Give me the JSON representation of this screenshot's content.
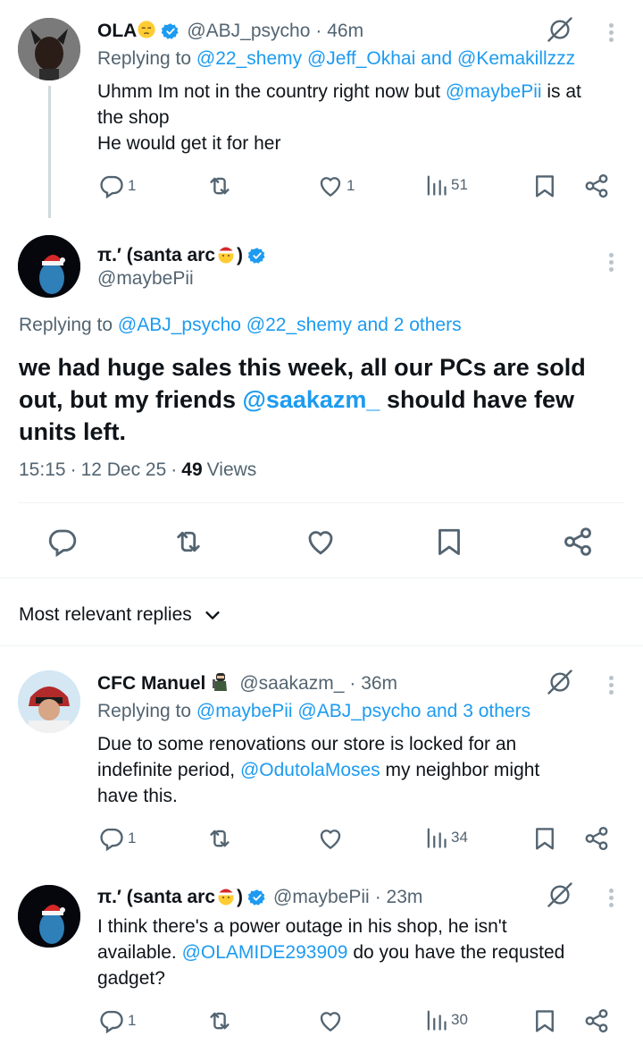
{
  "tweet1": {
    "name": "OLA",
    "handle": "@ABJ_psycho",
    "time": "· 46m",
    "replying_prefix": "Replying to ",
    "replying_mentions": "@22_shemy @Jeff_Okhai",
    "replying_and": " and ",
    "replying_last": "@Kemakillzzz",
    "text_line1_a": "Uhmm Im not in the country right now but ",
    "text_line1_mention": "@maybePii",
    "text_line1_b": " is at",
    "text_line2": "the shop",
    "text_line3": "He would get it for her",
    "replies": "1",
    "likes": "1",
    "views": "51"
  },
  "tweet2": {
    "name": "π.′ (santa arc",
    "name_close": ")",
    "handle": "@maybePii",
    "replying_prefix": "Replying to ",
    "replying_mentions": "@ABJ_psycho @22_shemy",
    "replying_and": " and ",
    "replying_last": "2 others",
    "text_a": "we had huge sales this week, all our PCs are sold out, but my friends ",
    "text_mention": "@saakazm_",
    "text_b": " should have few units left.",
    "time": "15:15",
    "date": "12 Dec 25",
    "views_count": "49",
    "views_label": "Views"
  },
  "sort": {
    "label": "Most relevant replies"
  },
  "tweet3": {
    "name": "CFC Manuel",
    "handle": "@saakazm_",
    "time": "· 36m",
    "replying_prefix": "Replying to ",
    "replying_mentions": "@maybePii @ABJ_psycho",
    "replying_and": " and ",
    "replying_last": "3 others",
    "text_line1": "Due to some renovations our store is locked for an",
    "text_line2_a": "indefinite period, ",
    "text_line2_mention": "@OdutolaMoses",
    "text_line2_b": " my neighbor might",
    "text_line3": "have this.",
    "replies": "1",
    "views": "34"
  },
  "tweet4": {
    "name": "π.′ (santa arc",
    "name_close": ")",
    "handle": "@maybePii",
    "time": "· 23m",
    "text_line1": "I think there's a power outage in his shop, he isn't",
    "text_line2_a": "available. ",
    "text_line2_mention": "@OLAMIDE293909",
    "text_line2_b": " do you have the requsted",
    "text_line3": "gadget?",
    "replies": "1",
    "views": "30"
  },
  "icons": {
    "accent": "#1d9bf0",
    "muted": "#536471"
  }
}
